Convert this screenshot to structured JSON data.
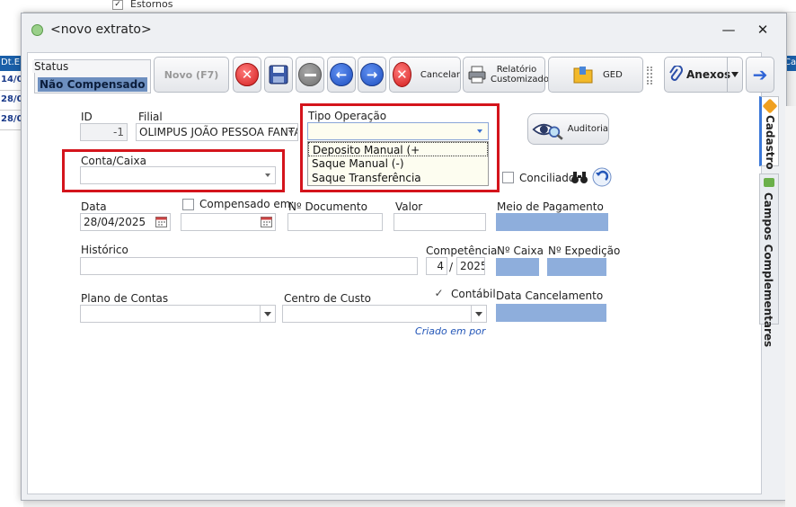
{
  "background": {
    "estornos_label": "Estornos",
    "grid_header": "Dt.E",
    "grid_rows": [
      "14/04",
      "28/04",
      "28/04"
    ],
    "right_header": "Ca"
  },
  "dialog": {
    "title": "<novo extrato>",
    "minimize_glyph": "—",
    "close_glyph": "✕"
  },
  "toolbar": {
    "status_label": "Status",
    "status_value": "Não Compensado",
    "novo_label": "Novo (F7)",
    "cancelar_label": "Cancelar",
    "relatorio_label": "Relatório Customizado",
    "ged_label": "GED",
    "anexos_label": "Anexos",
    "arrow_left": "←",
    "arrow_right": "→",
    "next_arrow": "➔"
  },
  "form": {
    "id_label": "ID",
    "id_value": "-1",
    "filial_label": "Filial",
    "filial_value": "OLIMPUS JOÃO PESSOA FANTA",
    "tipo_operacao_label": "Tipo Operação",
    "tipo_operacao_value": "",
    "tipo_operacao_options": [
      "Deposito Manual (+",
      "Saque Manual (-)",
      "Saque Transferência"
    ],
    "auditoria_label": "Auditoria",
    "conta_caixa_label": "Conta/Caixa",
    "conta_caixa_value": "",
    "conciliado_label": "Conciliado",
    "data_label": "Data",
    "data_value": "28/04/2025",
    "compensado_label": "Compensado em:",
    "compensado_value": "",
    "documento_label": "Nº Documento",
    "documento_value": "",
    "valor_label": "Valor",
    "valor_value": "",
    "meio_pagamento_label": "Meio de Pagamento",
    "historico_label": "Histórico",
    "historico_value": "",
    "competencia_label": "Competência",
    "competencia_month": "4",
    "competencia_sep": "/",
    "competencia_year": "2025",
    "n_caixa_label": "Nº Caixa",
    "n_expedicao_label": "Nº Expedição",
    "plano_contas_label": "Plano de Contas",
    "centro_custo_label": "Centro de Custo",
    "contabil_label": "Contábil",
    "contabil_checked": "✓",
    "data_cancelamento_label": "Data Cancelamento",
    "criado_em_label": "Criado em  por"
  },
  "side_tabs": {
    "cadastro": "Cadastro",
    "campos_complementares": "Campos Complementares"
  },
  "colors": {
    "highlight_red": "#d4141c",
    "status_blue": "#6d8fbf",
    "readonly_blue": "#8eaedc"
  }
}
